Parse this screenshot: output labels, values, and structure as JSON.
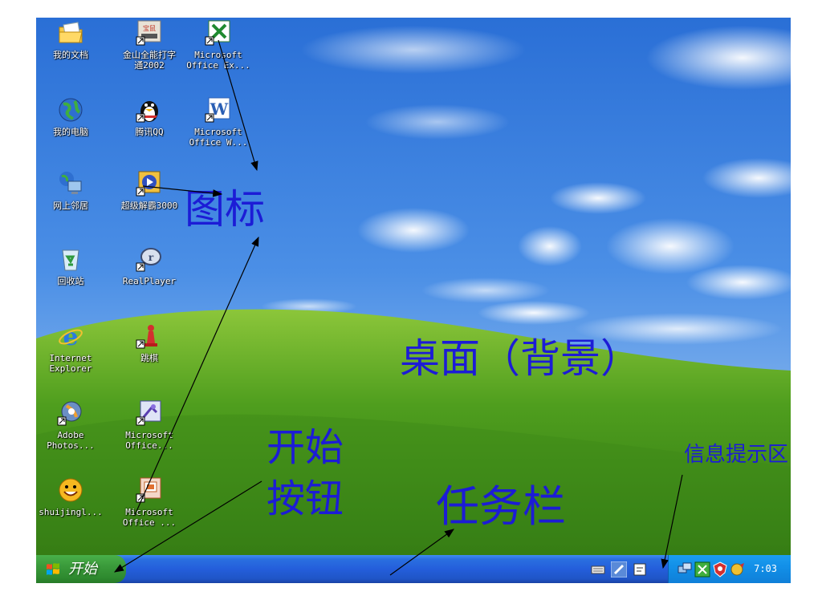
{
  "desktop": {
    "icons": [
      {
        "label": "我的文档",
        "icon": "my-documents-folder-icon"
      },
      {
        "label": "金山全能打字\n通2002",
        "icon": "typing-app-icon"
      },
      {
        "label": "Microsoft\nOffice Ex...",
        "icon": "excel-icon"
      },
      {
        "label": "我的电脑",
        "icon": "my-computer-globe-icon"
      },
      {
        "label": "腾讯QQ",
        "icon": "qq-penguin-icon"
      },
      {
        "label": "Microsoft\nOffice W...",
        "icon": "word-icon"
      },
      {
        "label": "网上邻居",
        "icon": "network-neighborhood-icon"
      },
      {
        "label": "超级解霸3000",
        "icon": "media-player-icon"
      },
      {
        "label": "回收站",
        "icon": "recycle-bin-icon"
      },
      {
        "label": "RealPlayer",
        "icon": "realplayer-icon"
      },
      {
        "label": "Internet\nExplorer",
        "icon": "internet-explorer-icon"
      },
      {
        "label": "跳棋",
        "icon": "chinese-checkers-icon"
      },
      {
        "label": "Adobe\nPhotos...",
        "icon": "photoshop-icon"
      },
      {
        "label": "Microsoft\nOffice...",
        "icon": "office-tool-icon"
      },
      {
        "label": "shuijingl...",
        "icon": "smiley-app-icon"
      },
      {
        "label": "Microsoft\nOffice ...",
        "icon": "powerpoint-icon"
      }
    ],
    "shortcut_mark": "↗"
  },
  "taskbar": {
    "start_label": "开始",
    "quick_icons": [
      "keyboard-icon",
      "pen-icon",
      "ime-icon"
    ],
    "tray_icons": [
      "network-icon",
      "volume-icon",
      "antivirus-icon",
      "security-icon"
    ],
    "clock": "7:03"
  },
  "annotations": {
    "icons": "图标",
    "desktop": "桌面（背景）",
    "start_button_line1": "开始",
    "start_button_line2": "按钮",
    "taskbar": "任务栏",
    "notification_area": "信息提示区"
  },
  "colors": {
    "annotation": "#1c1cd6",
    "taskbar": "#245edb",
    "start_button": "#3a9a3a",
    "tray": "#0f7fd8"
  }
}
